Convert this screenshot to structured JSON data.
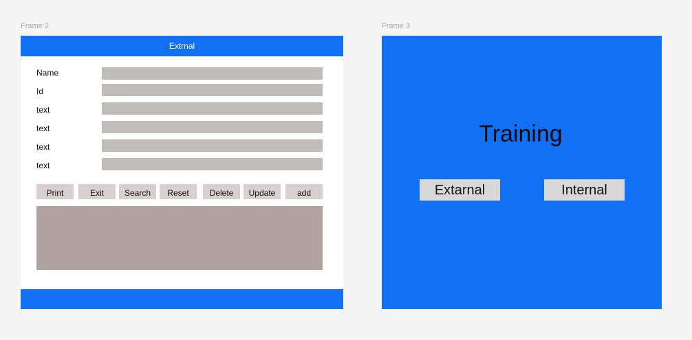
{
  "frames": {
    "frame2_label": "Frame 2",
    "frame3_label": "Frame 3"
  },
  "form": {
    "header_title": "Extrnal",
    "fields": [
      {
        "label": "Name",
        "value": ""
      },
      {
        "label": "Id",
        "value": ""
      },
      {
        "label": "text",
        "value": ""
      },
      {
        "label": "text",
        "value": ""
      },
      {
        "label": "text",
        "value": ""
      },
      {
        "label": "text",
        "value": ""
      }
    ],
    "buttons": {
      "print": "Print",
      "exit": "Exit",
      "search": "Search",
      "reset": "Reset",
      "delete": "Delete",
      "update": "Update",
      "add": "add"
    }
  },
  "training": {
    "title": "Training",
    "external_label": "Extarnal",
    "internal_label": "Internal"
  },
  "colors": {
    "accent": "#1170f3",
    "input_bg": "#c0bcbb",
    "button_bg": "#d8d0d0",
    "output_bg": "#b0a2a1"
  }
}
